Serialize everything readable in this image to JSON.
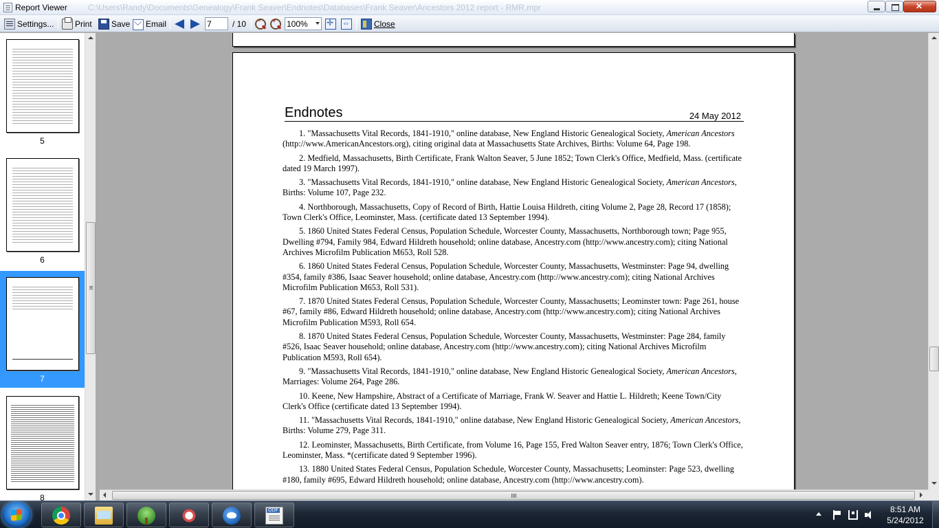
{
  "window": {
    "title": "Report Viewer",
    "path": "C:\\Users\\Randy\\Documents\\Genealogy\\Frank Seaver\\Endnotes\\Databases\\Frank Seaver\\Ancestors 2012 report - RMR.mpr"
  },
  "toolbar": {
    "settings_label": "Settings...",
    "print_label": "Print",
    "save_label": "Save",
    "email_label": "Email",
    "current_page": "7",
    "page_total": "/ 10",
    "zoom_value": "100%",
    "close_label": "Close"
  },
  "thumbnails": [
    {
      "label": "5",
      "selected": false
    },
    {
      "label": "6",
      "selected": false
    },
    {
      "label": "7",
      "selected": true
    },
    {
      "label": "8",
      "selected": false
    }
  ],
  "document": {
    "heading": "Endnotes",
    "date": "24 May 2012",
    "notes": [
      {
        "num": "1.",
        "pre": "\"Massachusetts Vital Records, 1841-1910,\" online database,  New England Historic Genealogical Society, ",
        "italic": "American Ancestors",
        "post": " (http://www.AmericanAncestors.org), citing original data at Massachusetts State Archives, Births: Volume 64, Page 198."
      },
      {
        "num": "2.",
        "pre": "Medfield, Massachusetts, Birth Certificate, Frank Walton Seaver, 5 June 1852; Town Clerk's Office, Medfield, Mass. (certificate dated 19 March 1997).",
        "italic": "",
        "post": ""
      },
      {
        "num": "3.",
        "pre": "\"Massachusetts Vital Records, 1841-1910,\" online database,  New England Historic Genealogical Society, ",
        "italic": "American Ancestors",
        "post": ", Births: Volume 107, Page 232."
      },
      {
        "num": "4.",
        "pre": "Northborough, Massachusetts, Copy of Record of Birth, Hattie Louisa Hildreth, citing Volume 2, Page 28, Record 17 (1858); Town Clerk's Office, Leominster, Mass. (certificate dated 13 September 1994).",
        "italic": "",
        "post": ""
      },
      {
        "num": "5.",
        "pre": "1860 United States Federal Census, Population Schedule, Worcester County, Massachusetts, Northborough town; Page 955, Dwelling #794, Family 984, Edward Hildreth household; online database, Ancestry.com (http://www.ancestry.com); citing National Archives Microfilm Publication M653, Roll 528.",
        "italic": "",
        "post": ""
      },
      {
        "num": "6.",
        "pre": "1860 United States Federal Census, Population Schedule, Worcester County, Massachusetts, Westminster:  Page 94, dwelling #354, family #386, Isaac Seaver household; online database, Ancestry.com (http://www.ancestry.com); citing National Archives Microfilm Publication M653, Roll 531).",
        "italic": "",
        "post": ""
      },
      {
        "num": "7.",
        "pre": "1870 United States Federal Census, Population Schedule, Worcester County, Massachusetts; Leominster town: Page 261, house #67, family #86, Edward Hildreth household; online database, Ancestry.com (http://www.ancestry.com); citing National Archives Microfilm Publication M593, Roll 654.",
        "italic": "",
        "post": ""
      },
      {
        "num": "8.",
        "pre": "1870 United States Federal Census, Population Schedule, Worcester County, Massachusetts, Westminster: Page 284, family #526, Isaac Seaver household; online database, Ancestry.com (http://www.ancestry.com); citing National Archives Microfilm Publication M593, Roll 654).",
        "italic": "",
        "post": ""
      },
      {
        "num": "9.",
        "pre": "\"Massachusetts Vital Records, 1841-1910,\" online database,  New England Historic Genealogical Society, ",
        "italic": "American Ancestors",
        "post": ", Marriages: Volume 264, Page 286."
      },
      {
        "num": "10.",
        "pre": "Keene, New Hampshire, Abstract of a Certificate of Marriage, Frank W. Seaver and Hattie L. Hildreth; Keene Town/City Clerk's Office (certificate dated 13 September 1994).",
        "italic": "",
        "post": ""
      },
      {
        "num": "11.",
        "pre": "\"Massachusetts Vital Records, 1841-1910,\" online database,  New England Historic Genealogical Society, ",
        "italic": "American Ancestors",
        "post": ", Births: Volume 279, Page 311."
      },
      {
        "num": "12.",
        "pre": "Leominster, Massachusetts, Birth Certificate, from Volume 16, Page 155, Fred Walton Seaver entry, 1876; Town Clerk's Office, Leominster, Mass. *(certificate dated 9 September 1996).",
        "italic": "",
        "post": ""
      },
      {
        "num": "13.",
        "pre": "1880 United States Federal Census, Population Schedule, Worcester County, Massachusetts; Leominster: Page 523, dwelling #180, family #695, Edward Hildreth household; online database, Ancestry.com (http://www.ancestry.com).",
        "italic": "",
        "post": ""
      }
    ]
  },
  "taskbar": {
    "apps": [
      {
        "name": "chrome-icon"
      },
      {
        "name": "folder-icon"
      },
      {
        "name": "family-tree-icon"
      },
      {
        "name": "snipping-tool-icon"
      },
      {
        "name": "thunderbird-icon"
      },
      {
        "name": "odf-viewer-icon"
      }
    ],
    "time": "8:51 AM",
    "date": "5/24/2012"
  },
  "colors": {
    "selection": "#3399ff",
    "workspace": "#ababab",
    "nav_arrow": "#1b4fa8"
  }
}
